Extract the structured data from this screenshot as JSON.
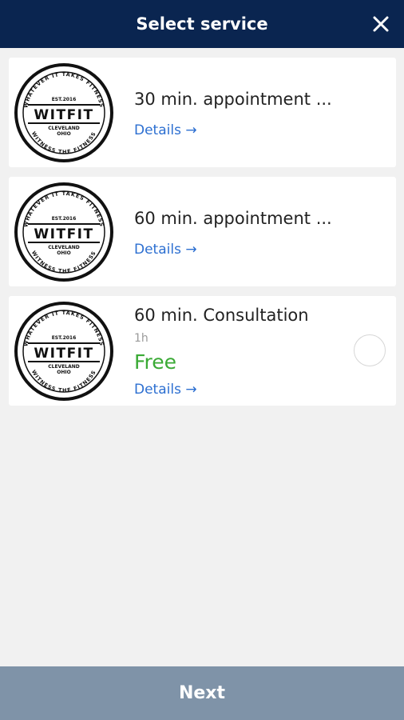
{
  "header": {
    "title": "Select service",
    "close_icon": "close-icon",
    "background_color": "#0a2550"
  },
  "logo": {
    "brand": "WITFIT",
    "est": "EST.2016",
    "location_line1": "CLEVELAND",
    "location_line2": "OHIO",
    "ring_top": "WHATEVER IT TAKES FITNESS",
    "ring_bottom": "WITNESS THE FITNESS"
  },
  "services": [
    {
      "name": "30 min. appointment ...",
      "details_label": "Details →"
    },
    {
      "name": "60 min. appointment ...",
      "details_label": "Details →"
    },
    {
      "name": "60 min. Consultation",
      "duration": "1h",
      "price": "Free",
      "details_label": "Details →",
      "selected": false
    }
  ],
  "colors": {
    "link": "#2c6fd1",
    "price_free": "#3aaa35",
    "footer_button": "#7f93a8"
  },
  "footer": {
    "next_label": "Next"
  }
}
